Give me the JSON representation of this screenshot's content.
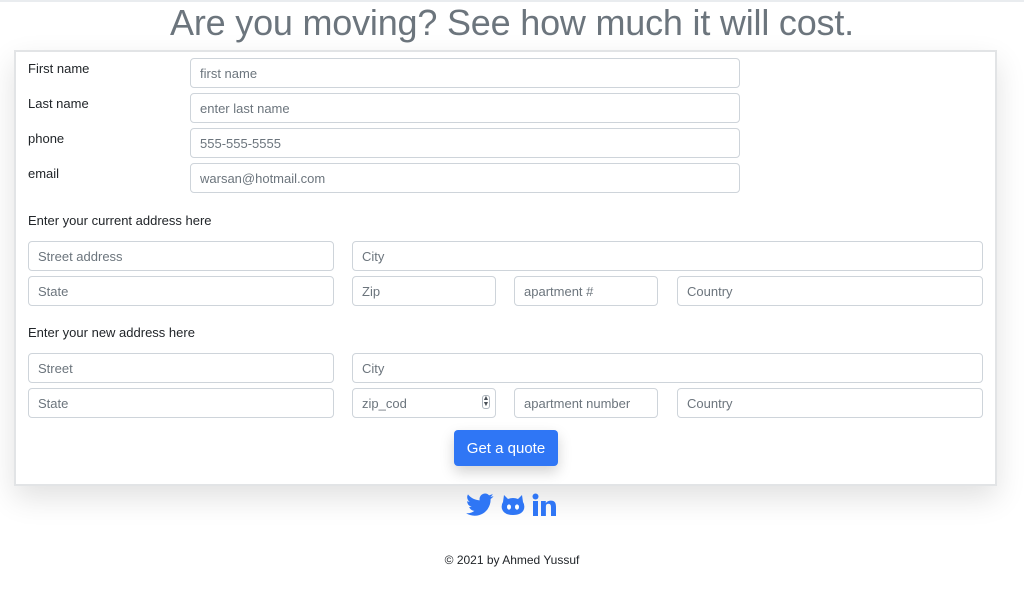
{
  "title": "Are you moving? See how much it will cost.",
  "personal": {
    "first_name_label": "First name",
    "first_name_placeholder": "first name",
    "last_name_label": "Last name",
    "last_name_placeholder": "enter last name",
    "phone_label": "phone",
    "phone_placeholder": "555-555-5555",
    "email_label": "email",
    "email_placeholder": "warsan@hotmail.com"
  },
  "current_address": {
    "heading": "Enter your current address here",
    "street_placeholder": "Street address",
    "city_placeholder": "City",
    "state_placeholder": "State",
    "zip_placeholder": "Zip",
    "apartment_placeholder": "apartment #",
    "country_placeholder": "Country"
  },
  "new_address": {
    "heading": "Enter your new address here",
    "street_placeholder": "Street",
    "city_placeholder": "City",
    "state_placeholder": "State",
    "zip_placeholder": "zip_cod",
    "apartment_placeholder": "apartment number",
    "country_placeholder": "Country"
  },
  "button": {
    "label": "Get a quote"
  },
  "socials": [
    "twitter-icon",
    "github-icon",
    "linkedin-icon"
  ],
  "footer": {
    "text": "© 2021 by Ahmed Yussuf"
  },
  "colors": {
    "accent": "#2f76f5",
    "title": "#6c757d",
    "border": "#ced4da"
  }
}
